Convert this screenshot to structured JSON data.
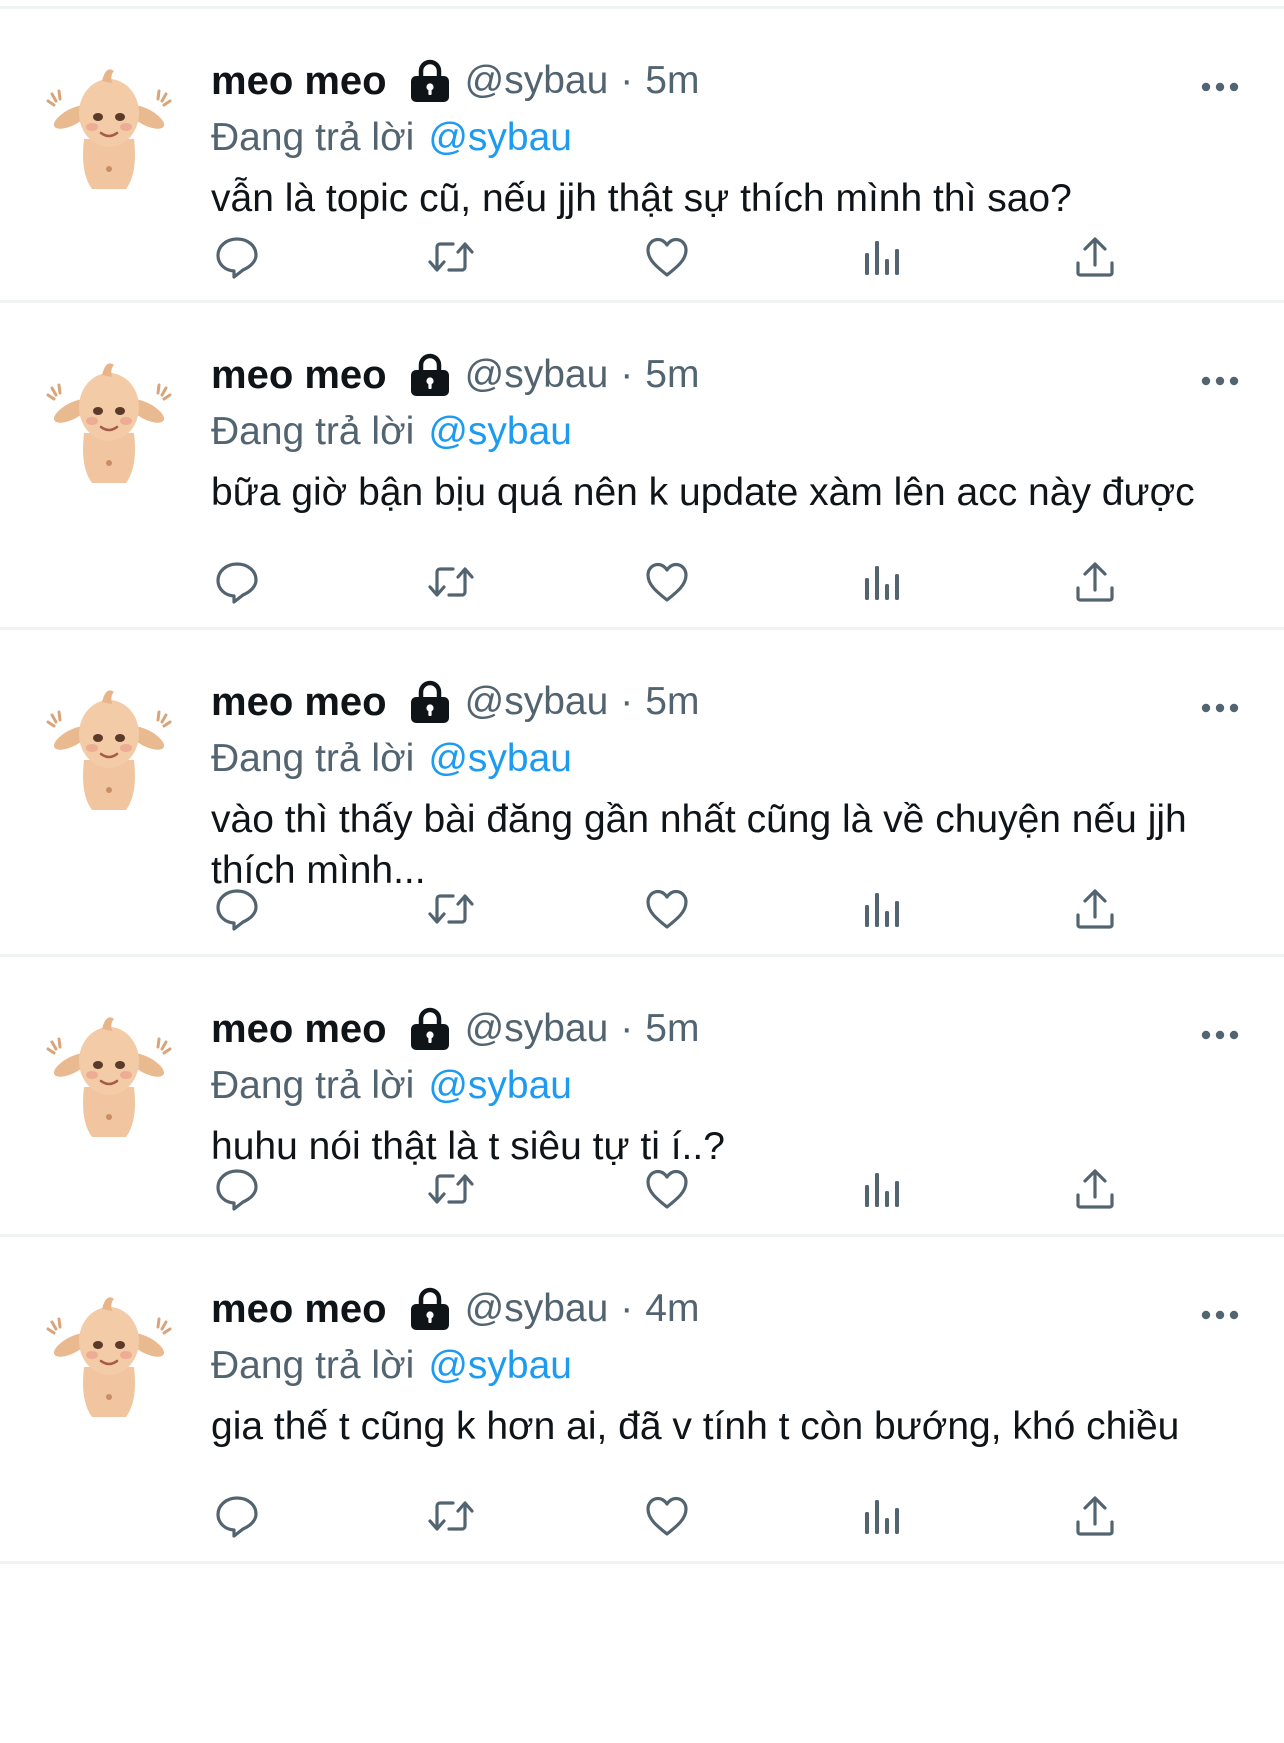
{
  "tweets": [
    {
      "display_name": "meo meo",
      "handle": "@sybau",
      "separator": "·",
      "time": "5m",
      "replying_prefix": "Đang trả lời",
      "replying_to": "@sybau",
      "text": "vẫn là topic cũ, nếu jjh thật sự thích mình thì sao?"
    },
    {
      "display_name": "meo meo",
      "handle": "@sybau",
      "separator": "·",
      "time": "5m",
      "replying_prefix": "Đang trả lời",
      "replying_to": "@sybau",
      "text": "bữa giờ bận bịu quá nên k update xàm lên acc này được"
    },
    {
      "display_name": "meo meo",
      "handle": "@sybau",
      "separator": "·",
      "time": "5m",
      "replying_prefix": "Đang trả lời",
      "replying_to": "@sybau",
      "text": "vào thì thấy bài đăng gần nhất cũng là về chuyện nếu jjh thích mình..."
    },
    {
      "display_name": "meo meo",
      "handle": "@sybau",
      "separator": "·",
      "time": "5m",
      "replying_prefix": "Đang trả lời",
      "replying_to": "@sybau",
      "text": "huhu nói thật là t siêu tự ti í..?"
    },
    {
      "display_name": "meo meo",
      "handle": "@sybau",
      "separator": "·",
      "time": "4m",
      "replying_prefix": "Đang trả lời",
      "replying_to": "@sybau",
      "text": "gia thế t cũng k hơn ai, đã v tính t còn bướng, khó chiều"
    }
  ],
  "icons": {
    "protected": "lock-icon",
    "more": "more-icon",
    "actions": [
      "reply-icon",
      "retweet-icon",
      "like-icon",
      "views-icon",
      "share-icon"
    ]
  },
  "colors": {
    "text": "#0f1419",
    "secondary": "#536471",
    "link": "#1d9bf0",
    "divider": "#eff3f4"
  }
}
